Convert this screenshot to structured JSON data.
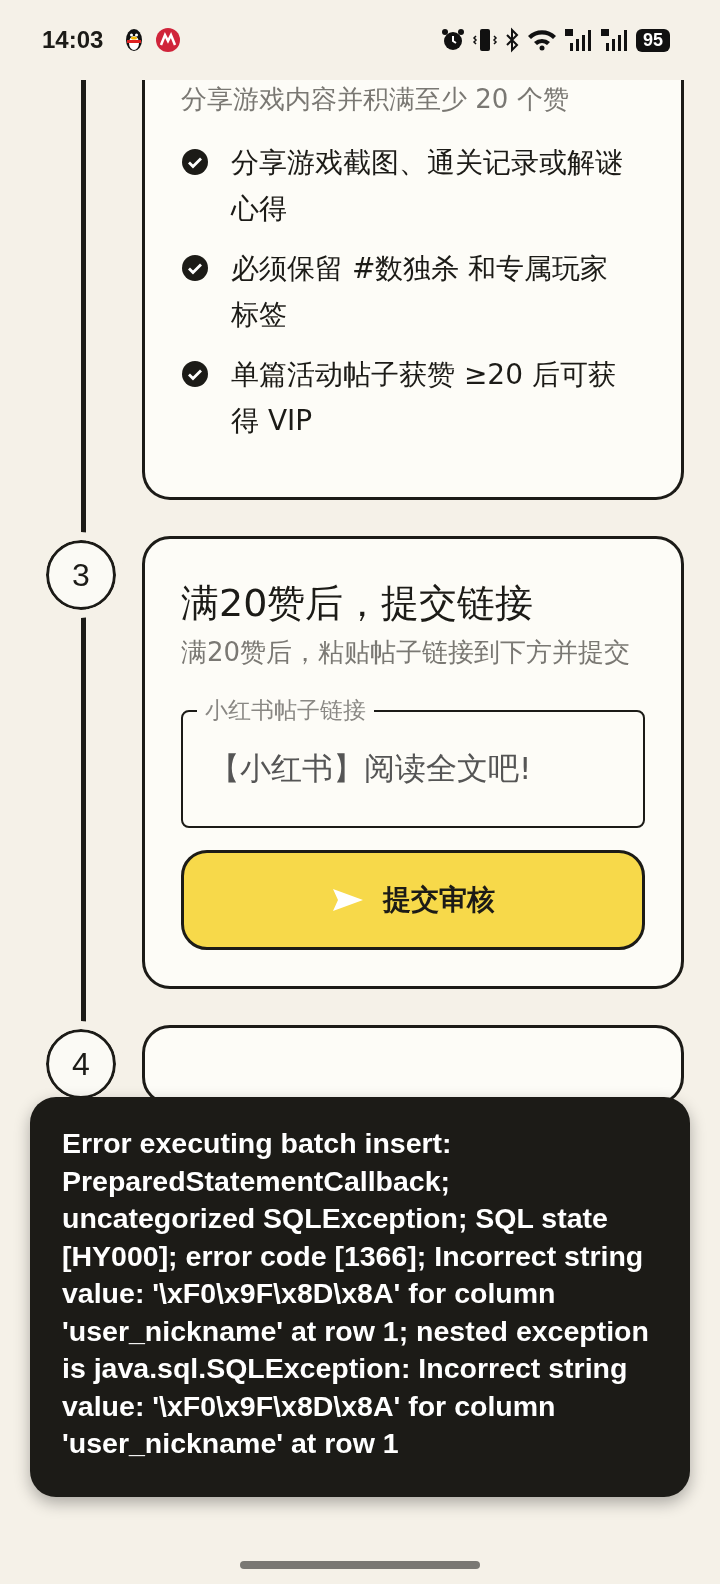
{
  "status_bar": {
    "time": "14:03",
    "battery": "95"
  },
  "steps": [
    {
      "subtitle": "分享游戏内容并积满至少 20 个赞",
      "checklist": [
        {
          "text": "分享游戏截图、通关记录或解谜心得",
          "checked": true
        },
        {
          "text": "必须保留 #数独杀 和专属玩家标签",
          "checked": true
        },
        {
          "text": "单篇活动帖子获赞 ≥20 后可获得 VIP",
          "checked": true
        }
      ]
    },
    {
      "number": "3",
      "title": "满20赞后，提交链接",
      "subtitle": "满20赞后，粘贴帖子链接到下方并提交",
      "field": {
        "label": "小红书帖子链接",
        "value": "【小红书】阅读全文吧!"
      },
      "button": "提交审核"
    },
    {
      "number": "4"
    }
  ],
  "toast": {
    "message": "Error executing batch insert: PreparedStatementCallback; uncategorized SQLException; SQL state [HY000]; error code [1366]; Incorrect string value: '\\xF0\\x9F\\x8D\\x8A' for column 'user_nickname' at row 1; nested exception is java.sql.SQLException: Incorrect string value: '\\xF0\\x9F\\x8D\\x8A' for column 'user_nickname' at row 1"
  }
}
